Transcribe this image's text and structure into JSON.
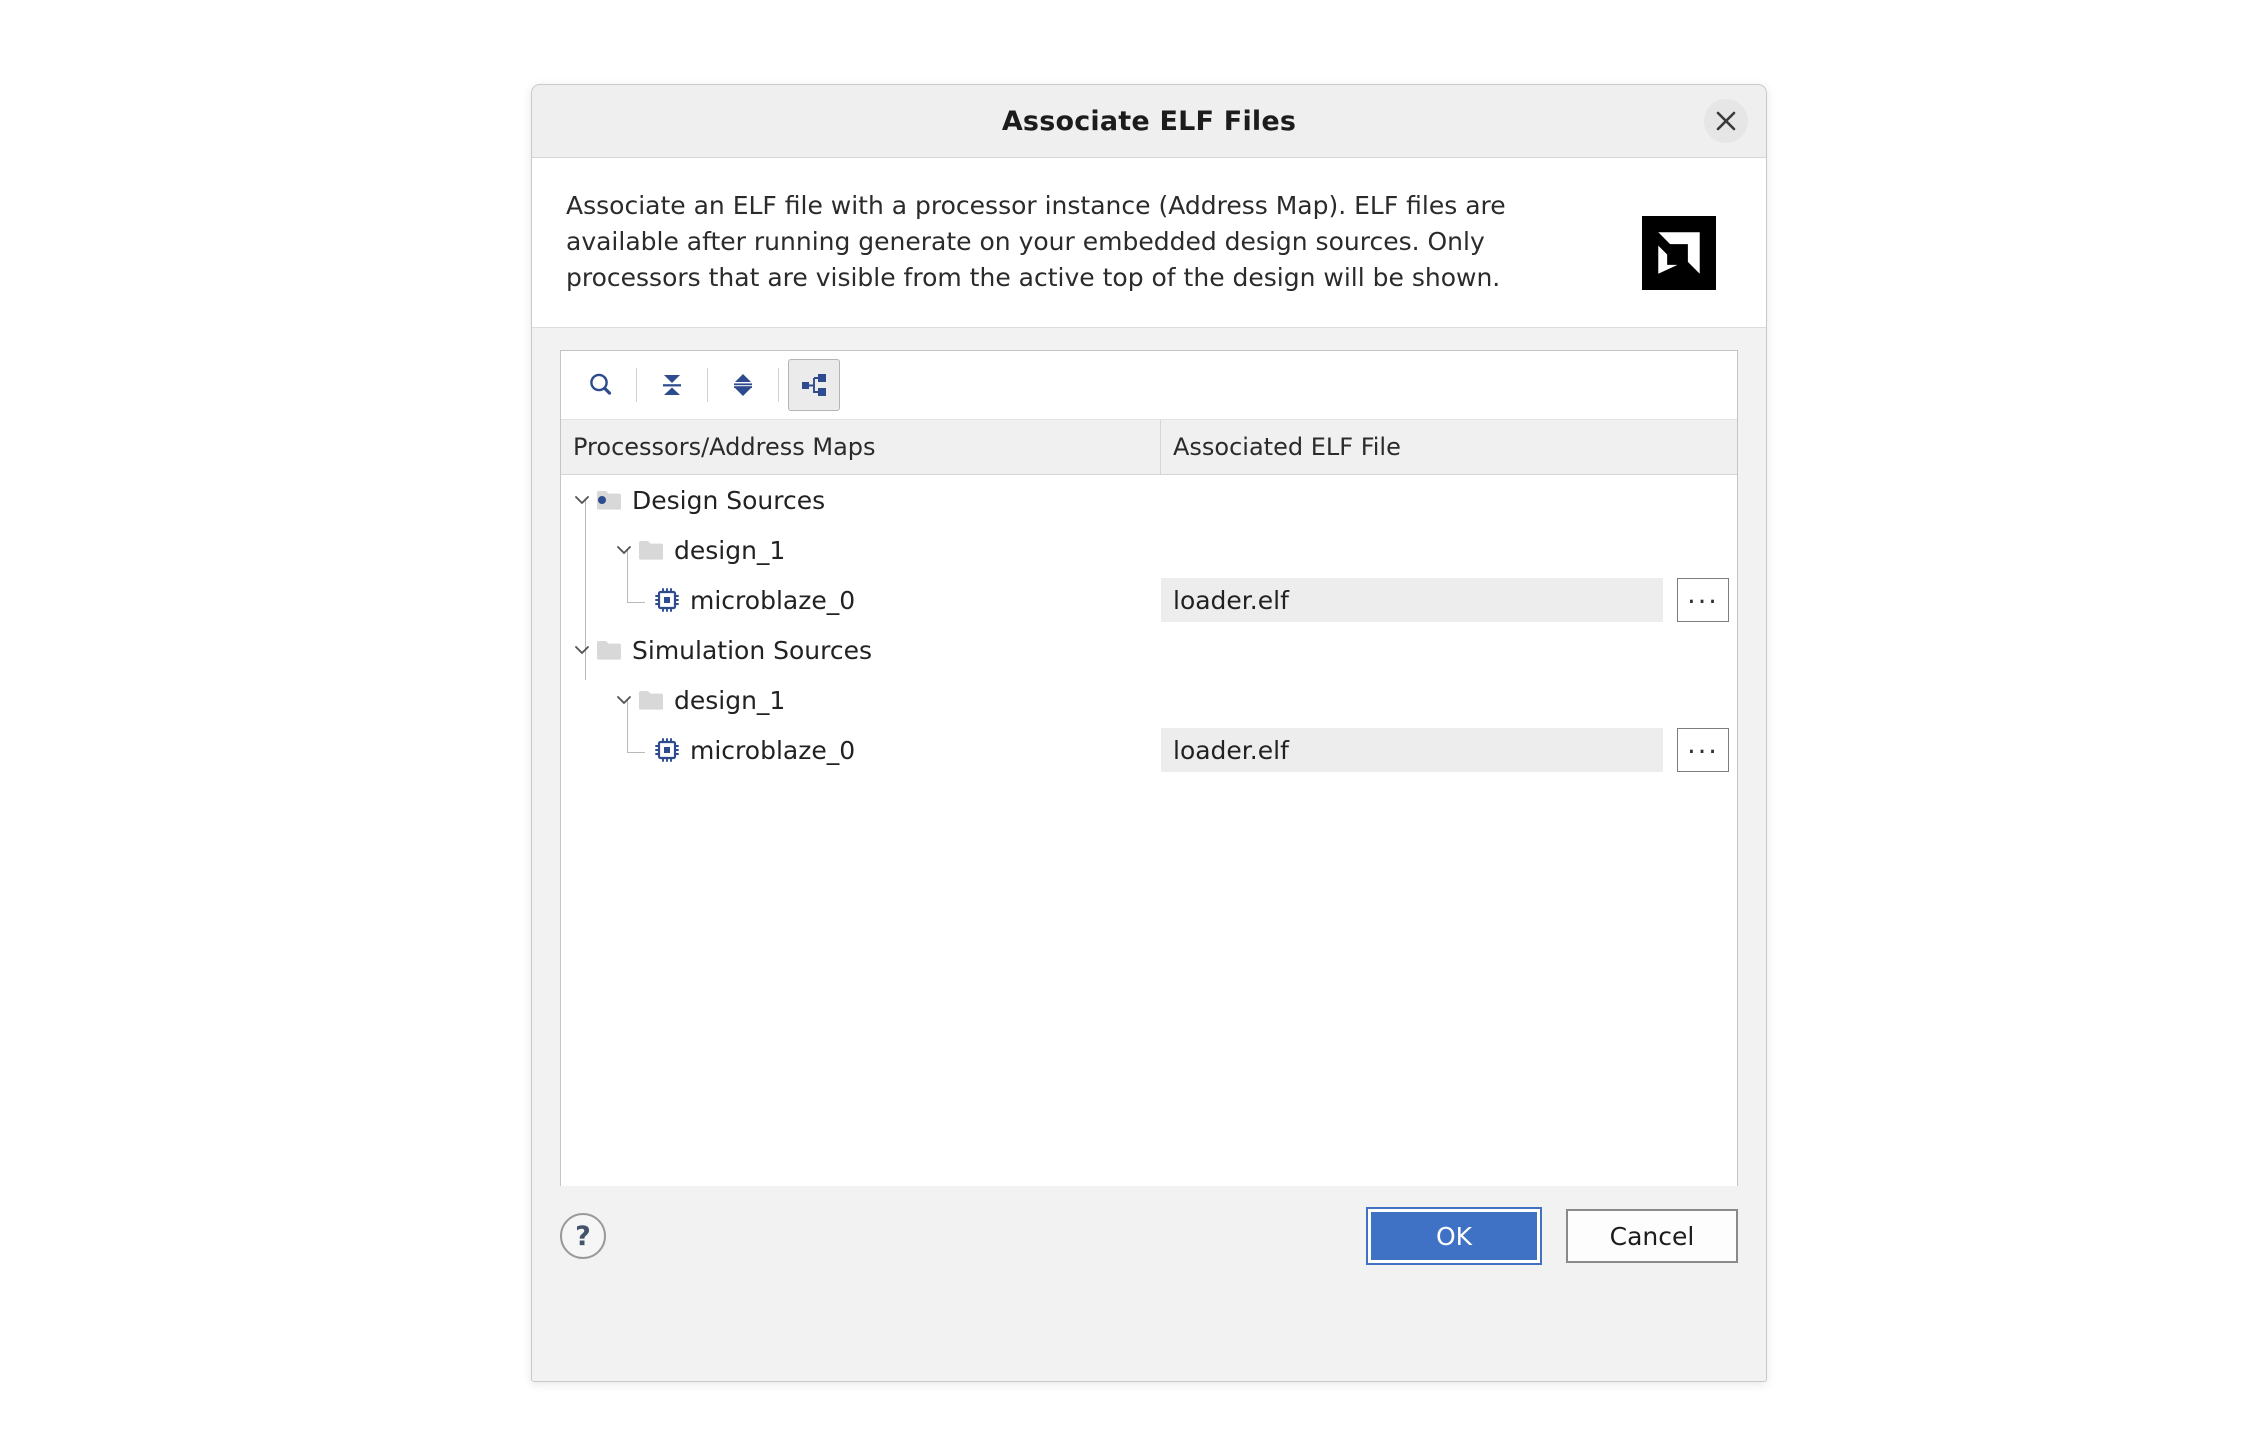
{
  "dialog": {
    "title": "Associate ELF Files",
    "close_icon": "close-icon",
    "description": "Associate an ELF file with a processor instance (Address Map). ELF files are available after running generate on your embedded design sources. Only processors that are visible from the active top of the design will be shown.",
    "logo_name": "amd-logo"
  },
  "toolbar": {
    "buttons": [
      {
        "name": "search-icon",
        "label": "Search"
      },
      {
        "name": "collapse-all-icon",
        "label": "Collapse All"
      },
      {
        "name": "expand-all-icon",
        "label": "Expand All"
      },
      {
        "name": "hierarchy-icon",
        "label": "Hierarchy",
        "active": true
      }
    ]
  },
  "tree": {
    "columns": [
      "Processors/Address Maps",
      "Associated ELF File"
    ],
    "rows": [
      {
        "label": "Design Sources",
        "depth": 0,
        "icon": "folder-design-sources-icon",
        "expanded": true,
        "elf": ""
      },
      {
        "label": "design_1",
        "depth": 1,
        "icon": "folder-icon",
        "expanded": true,
        "elf": ""
      },
      {
        "label": "microblaze_0",
        "depth": 2,
        "icon": "cpu-chip-icon",
        "expanded": false,
        "elf": "loader.elf"
      },
      {
        "label": "Simulation Sources",
        "depth": 0,
        "icon": "folder-icon",
        "expanded": true,
        "elf": ""
      },
      {
        "label": "design_1",
        "depth": 1,
        "icon": "folder-icon",
        "expanded": true,
        "elf": ""
      },
      {
        "label": "microblaze_0",
        "depth": 2,
        "icon": "cpu-chip-icon",
        "expanded": false,
        "elf": "loader.elf"
      }
    ],
    "browse_label": "..."
  },
  "footer": {
    "help_label": "?",
    "ok_label": "OK",
    "cancel_label": "Cancel"
  },
  "colors": {
    "accent_blue": "#3f72c4",
    "icon_blue": "#2d4b8e",
    "dialog_bg": "#f2f2f2",
    "panel_bg": "#ffffff",
    "field_bg": "#ededed"
  }
}
